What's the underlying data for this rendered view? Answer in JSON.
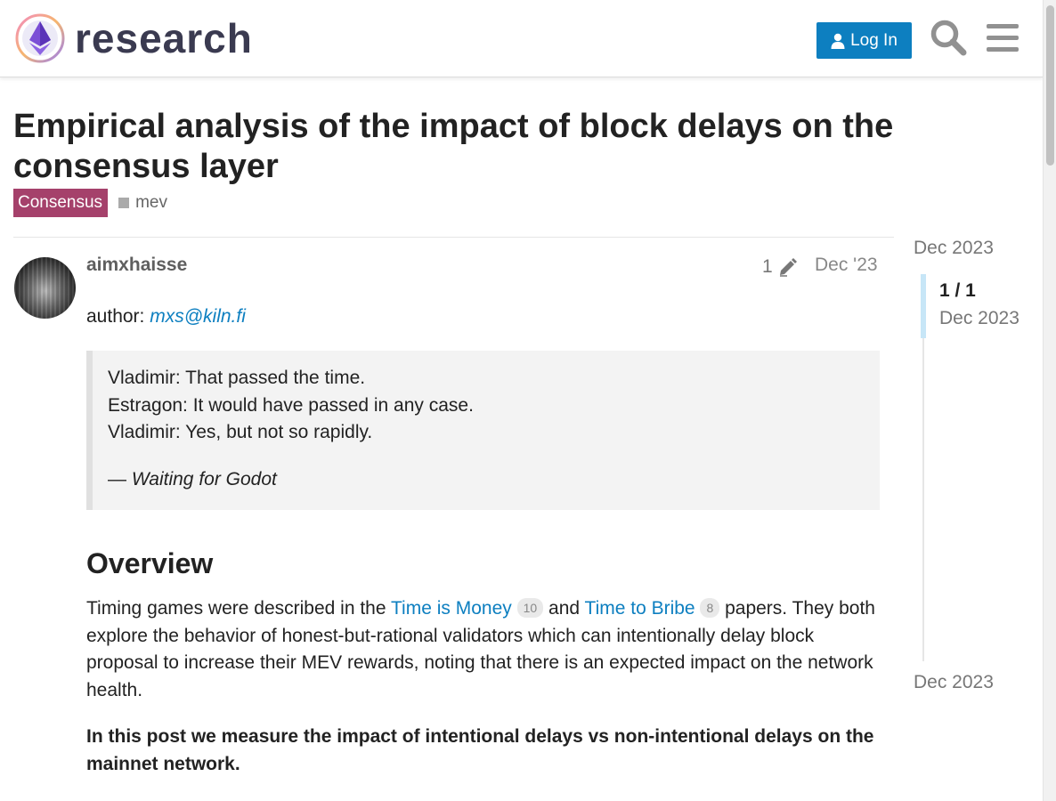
{
  "header": {
    "brand": "research",
    "login_label": "Log In"
  },
  "topic": {
    "title": "Empirical analysis of the impact of block delays on the consensus layer",
    "category": "Consensus",
    "category_color": "#a5416b",
    "tag": "mev"
  },
  "post": {
    "username": "aimxhaisse",
    "edit_count": "1",
    "date": "Dec '23",
    "author_prefix": "author:",
    "author_link": "mxs@kiln.fi",
    "quote": {
      "line1": "Vladimir: That passed the time.",
      "line2": "Estragon: It would have passed in any case.",
      "line3": "Vladimir: Yes, but not so rapidly.",
      "attribution_dash": "— ",
      "attribution_source": "Waiting for Godot"
    },
    "heading": "Overview",
    "paragraph": {
      "text1": "Timing games were described in the ",
      "link1": "Time is Money",
      "link1_count": "10",
      "text2": " and ",
      "link2": "Time to Bribe",
      "link2_count": "8",
      "text3": " papers. They both explore the behavior of honest-but-rational validators which can intentionally delay block proposal to increase their MEV rewards, noting that there is an expected impact on the network health."
    },
    "bold_paragraph": "In this post we measure the impact of intentional delays vs non-intentional delays on the mainnet network."
  },
  "timeline": {
    "start": "Dec 2023",
    "position": "1 / 1",
    "current_date": "Dec 2023",
    "end": "Dec 2023"
  },
  "icons": [
    "logo-mark",
    "user-icon",
    "search-icon",
    "menu-icon",
    "pencil-icon"
  ],
  "colors": {
    "accent": "#0d7fc0",
    "category": "#a5416b"
  }
}
